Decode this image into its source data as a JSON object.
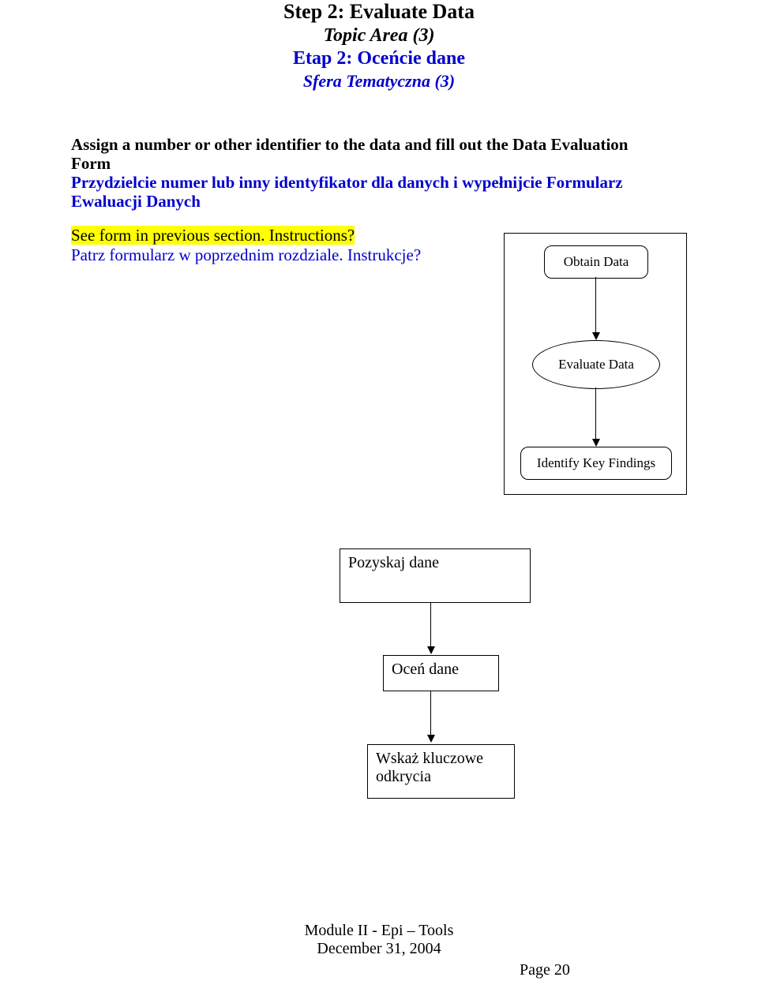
{
  "heading": {
    "title_en": "Step 2: Evaluate Data",
    "topic_en": "Topic Area (3)",
    "title_pl": "Etap 2: Oceńcie dane",
    "topic_pl": "Sfera Tematyczna (3)"
  },
  "body": {
    "assign_en_1": "Assign a number or other identifier to the data and fill out the Data Evaluation",
    "assign_en_2": "Form",
    "assign_pl_1": "Przydzielcie numer lub inny identyfikator dla danych i wypełnijcie Formularz",
    "assign_pl_2": "Ewaluacji Danych",
    "ref_en": "See form in previous section. Instructions?",
    "ref_pl": "Patrz formularz w poprzednim rozdziale. Instrukcje?"
  },
  "diagram1": {
    "node1": "Obtain Data",
    "node2": "Evaluate Data",
    "node3": "Identify Key Findings"
  },
  "diagram2": {
    "node1": "Pozyskaj dane",
    "node2": "Oceń dane",
    "node3": "Wskaż kluczowe odkrycia"
  },
  "footer": {
    "line1": "Module II - Epi – Tools",
    "line2": "December 31, 2004",
    "pagenum": "Page 20"
  }
}
